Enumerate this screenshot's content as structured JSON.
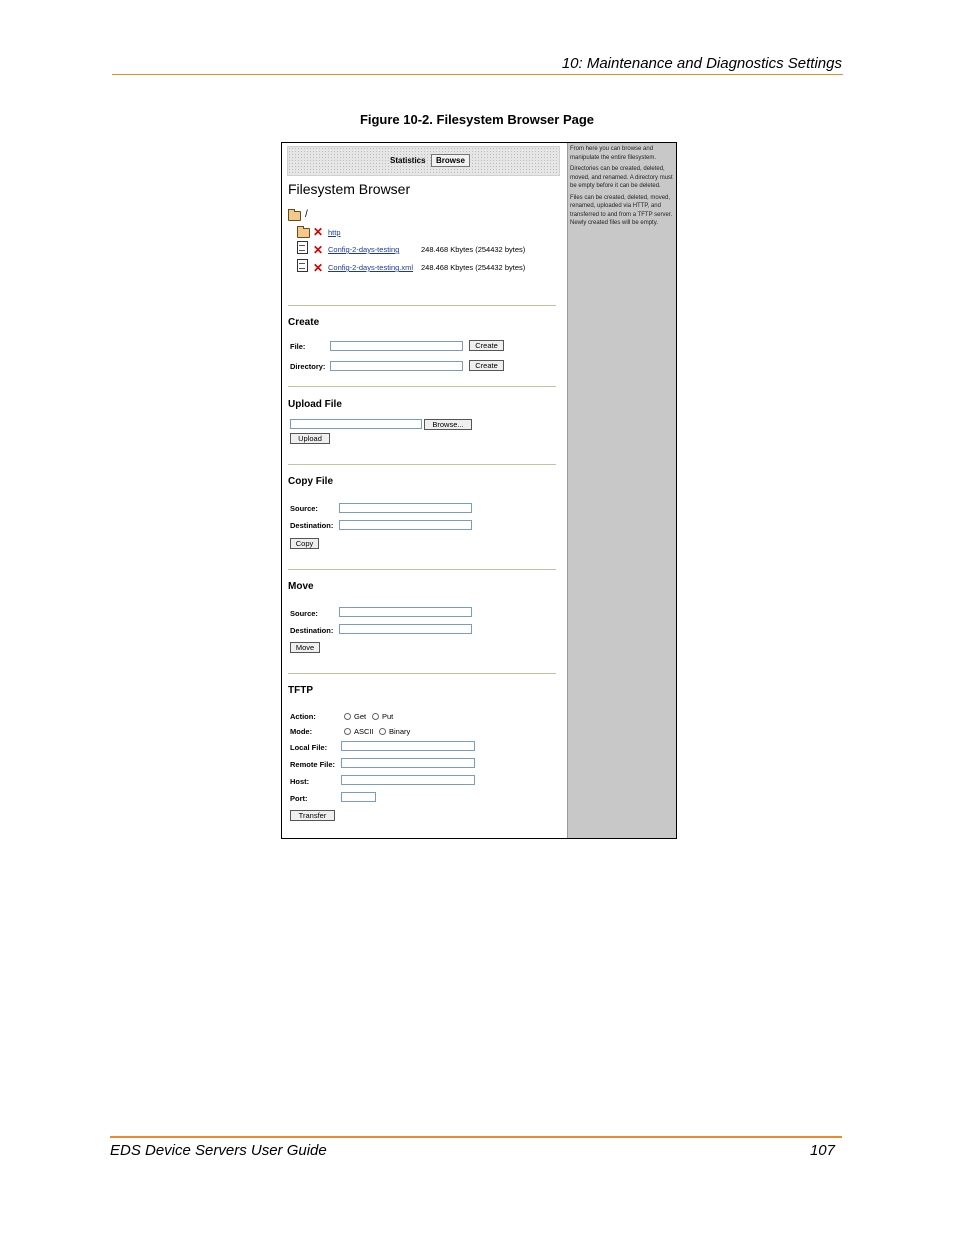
{
  "header": {
    "chapter": "10: Maintenance and Diagnostics Settings"
  },
  "figure": {
    "caption": "Figure 10-2. Filesystem Browser Page"
  },
  "screenshot": {
    "tabs": {
      "statistics": "Statistics",
      "browse": "Browse"
    },
    "title": "Filesystem Browser",
    "root": "/",
    "entries": [
      {
        "name": "http",
        "size": ""
      },
      {
        "name": "Config-2-days-testing",
        "size": "248.468 Kbytes (254432 bytes)"
      },
      {
        "name": "Config-2-days-testing.xml",
        "size": "248.468 Kbytes (254432 bytes)"
      }
    ],
    "create": {
      "heading": "Create",
      "file_label": "File:",
      "dir_label": "Directory:",
      "button": "Create"
    },
    "upload": {
      "heading": "Upload File",
      "browse_button": "Browse...",
      "upload_button": "Upload"
    },
    "copy": {
      "heading": "Copy File",
      "source_label": "Source:",
      "dest_label": "Destination:",
      "button": "Copy"
    },
    "move": {
      "heading": "Move",
      "source_label": "Source:",
      "dest_label": "Destination:",
      "button": "Move"
    },
    "tftp": {
      "heading": "TFTP",
      "action_label": "Action:",
      "action_get": "Get",
      "action_put": "Put",
      "mode_label": "Mode:",
      "mode_ascii": "ASCII",
      "mode_binary": "Binary",
      "local_label": "Local File:",
      "remote_label": "Remote File:",
      "host_label": "Host:",
      "port_label": "Port:",
      "button": "Transfer"
    },
    "help": {
      "p1": "From here you can browse and manipulate the entire filesystem.",
      "p2": "Directories can be created, deleted, moved, and renamed. A directory must be empty before it can be deleted.",
      "p3": "Files can be created, deleted, moved, renamed, uploaded via HTTP, and transferred to and from a TFTP server. Newly created files will be empty."
    }
  },
  "footer": {
    "guide": "EDS Device Servers User Guide",
    "page": "107"
  }
}
